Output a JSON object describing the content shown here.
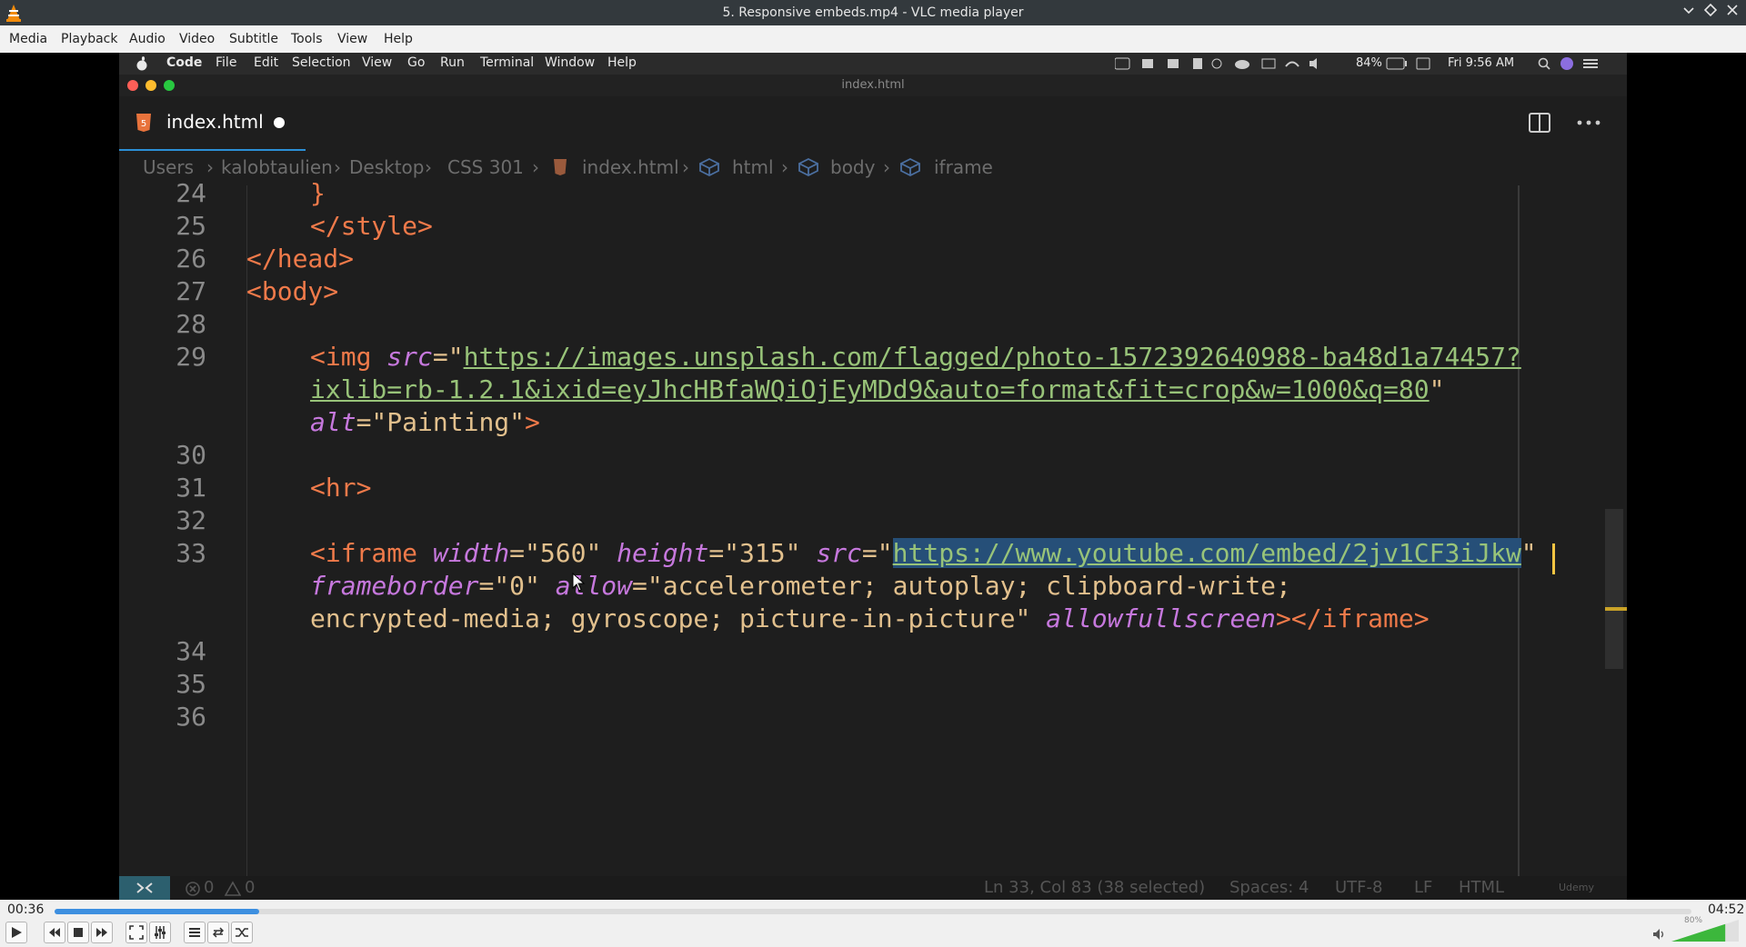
{
  "window": {
    "title": "5. Responsive embeds.mp4 - VLC media player"
  },
  "menu": [
    "Media",
    "Playback",
    "Audio",
    "Video",
    "Subtitle",
    "Tools",
    "View",
    "Help"
  ],
  "mac_menu": {
    "apple": "",
    "app": "Code",
    "items": [
      "File",
      "Edit",
      "Selection",
      "View",
      "Go",
      "Run",
      "Terminal",
      "Window",
      "Help"
    ],
    "battery": "84%",
    "clock": "Fri 9:56 AM"
  },
  "editor": {
    "window_title": "index.html",
    "tab_label": "index.html",
    "breadcrumbs": [
      "Users",
      "kalobtaulien",
      "Desktop",
      "CSS 301",
      "index.html",
      "html",
      "body",
      "iframe"
    ],
    "lines": {
      "n24": "24",
      "n25": "25",
      "n26": "26",
      "n27": "27",
      "n28": "28",
      "n29": "29",
      "n30": "30",
      "n31": "31",
      "n32": "32",
      "n33": "33",
      "n34": "34",
      "n35": "35",
      "n36": "36",
      "l24": "}",
      "l25": "</style>",
      "l26": "</head>",
      "l27": "<body>",
      "l29_tag": "<img ",
      "l29_attr": "src",
      "l29_eq": "=\"",
      "l29_url1": "https://images.unsplash.com/flagged/photo-1572392640988-ba48d1a74457?",
      "l29_url2": "ixlib=rb-1.2.1&ixid=eyJhcHBfaWQiOjEyMDd9&auto=format&fit=crop&w=1000&q=80",
      "l29_q": "\"",
      "l29_alt": "alt",
      "l29_altval": "=\"Painting\"",
      "l29_close": ">",
      "l31": "<hr>",
      "l33_tag": "<iframe ",
      "l33_w": "width",
      "l33_wv": "=\"560\" ",
      "l33_h": "height",
      "l33_hv": "=\"315\" ",
      "l33_src": "src",
      "l33_eq": "=\"",
      "l33_url": "https://www.youtube.com/embed/2jv1CF3iJkw",
      "l33_q": "\"",
      "l33b_fb": "frameborder",
      "l33b_fbv": "=\"0\" ",
      "l33b_allow": "allow",
      "l33b_allowv": "=\"accelerometer; autoplay; clipboard-write;",
      "l33c_allowv": "encrypted-media; gyroscope; picture-in-picture\" ",
      "l33c_afs": "allowfullscreen",
      "l33c_close": "></iframe>"
    },
    "status": {
      "errors": "0",
      "warnings": "0",
      "position": "Ln 33, Col 83 (38 selected)",
      "spaces": "Spaces: 4",
      "encoding": "UTF-8",
      "eol": "LF",
      "language": "HTML",
      "brand": "Udemy"
    }
  },
  "player": {
    "elapsed": "00:36",
    "total": "04:52",
    "progress": 0.125,
    "volume": "80%",
    "volume_level": 0.8
  },
  "colors": {
    "accent": "#3d8fe0",
    "tag": "#f07a4a",
    "attr": "#c678dd",
    "string": "#e2c08d",
    "url": "#98c379"
  }
}
